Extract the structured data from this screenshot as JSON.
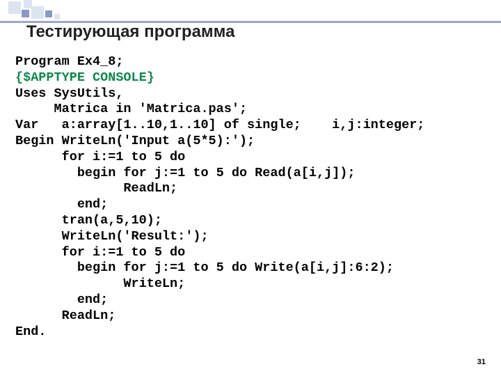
{
  "title": "Тестирующая программа",
  "pageNumber": "31",
  "code": {
    "l1": "Program Ex4_8;",
    "l2": "{$APPTYPE CONSOLE}",
    "l3": "Uses SysUtils,",
    "l4": "     Matrica in 'Matrica.pas';",
    "l5": "Var   a:array[1..10,1..10] of single;    i,j:integer;",
    "l6": "Begin WriteLn('Input a(5*5):');",
    "l7": "      for i:=1 to 5 do",
    "l8": "        begin for j:=1 to 5 do Read(a[i,j]);",
    "l9": "              ReadLn;",
    "l10": "        end;",
    "l11": "      tran(a,5,10);",
    "l12": "      WriteLn('Result:');",
    "l13": "      for i:=1 to 5 do",
    "l14": "        begin for j:=1 to 5 do Write(a[i,j]:6:2);",
    "l15": "              WriteLn;",
    "l16": "        end;",
    "l17": "      ReadLn;",
    "l18": "End."
  }
}
